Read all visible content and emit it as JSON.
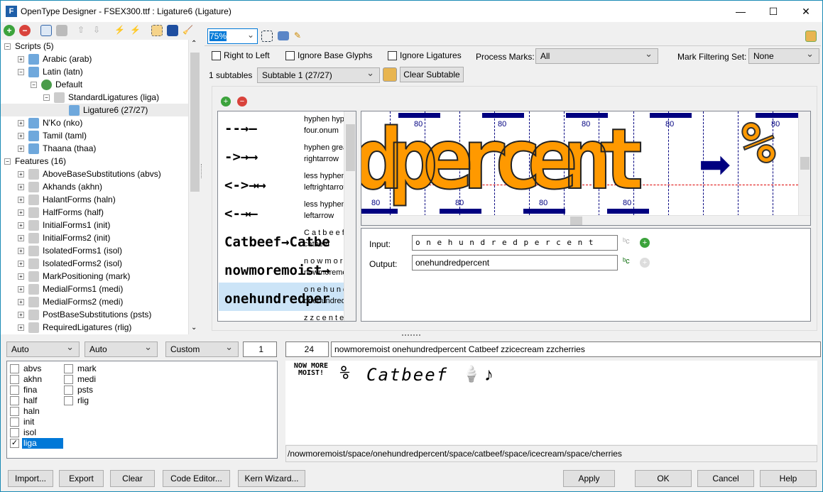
{
  "window": {
    "title": "OpenType Designer - FSEX300.ttf : Ligature6 (Ligature)",
    "minimize": "—",
    "maximize": "☐",
    "close": "✕"
  },
  "left_toolbar": {
    "icons": [
      "add-icon",
      "remove-icon",
      "tag-icon",
      "xyz-icon",
      "up-arrow-icon",
      "down-arrow-icon",
      "lightning-tag-icon",
      "lightning-disabled-icon",
      "tree-layout-icon",
      "window-icon",
      "broom-icon"
    ]
  },
  "tree": {
    "items": [
      {
        "label": "Scripts (5)",
        "level": 0,
        "expander": "−"
      },
      {
        "label": "Arabic (arab)",
        "level": 1,
        "expander": "+"
      },
      {
        "label": "Latin (latn)",
        "level": 1,
        "expander": "−"
      },
      {
        "label": "Default",
        "level": 2,
        "expander": "−"
      },
      {
        "label": "StandardLigatures (liga)",
        "level": 3,
        "expander": "−"
      },
      {
        "label": "Ligature6 (27/27)",
        "level": 4,
        "expander": "",
        "selected": true
      },
      {
        "label": "N'Ko (nko)",
        "level": 1,
        "expander": "+"
      },
      {
        "label": "Tamil (taml)",
        "level": 1,
        "expander": "+"
      },
      {
        "label": "Thaana (thaa)",
        "level": 1,
        "expander": "+"
      },
      {
        "label": "Features (16)",
        "level": 0,
        "expander": "−"
      },
      {
        "label": "AboveBaseSubstitutions (abvs)",
        "level": 1,
        "expander": "+"
      },
      {
        "label": "Akhands (akhn)",
        "level": 1,
        "expander": "+"
      },
      {
        "label": "HalantForms (haln)",
        "level": 1,
        "expander": "+"
      },
      {
        "label": "HalfForms (half)",
        "level": 1,
        "expander": "+"
      },
      {
        "label": "InitialForms1 (init)",
        "level": 1,
        "expander": "+"
      },
      {
        "label": "InitialForms2 (init)",
        "level": 1,
        "expander": "+"
      },
      {
        "label": "IsolatedForms1 (isol)",
        "level": 1,
        "expander": "+"
      },
      {
        "label": "IsolatedForms2 (isol)",
        "level": 1,
        "expander": "+"
      },
      {
        "label": "MarkPositioning (mark)",
        "level": 1,
        "expander": "+"
      },
      {
        "label": "MedialForms1 (medi)",
        "level": 1,
        "expander": "+"
      },
      {
        "label": "MedialForms2 (medi)",
        "level": 1,
        "expander": "+"
      },
      {
        "label": "PostBaseSubstitutions (psts)",
        "level": 1,
        "expander": "+"
      },
      {
        "label": "RequiredLigatures (rlig)",
        "level": 1,
        "expander": "+"
      }
    ]
  },
  "right_toolbar": {
    "zoom": "75%"
  },
  "options": {
    "right_to_left": "Right to Left",
    "ignore_base": "Ignore Base Glyphs",
    "ignore_lig": "Ignore Ligatures",
    "process_marks_label": "Process Marks:",
    "process_marks_value": "All",
    "mark_filter_label": "Mark Filtering Set:",
    "mark_filter_value": "None"
  },
  "subtables": {
    "count": "1 subtables",
    "selected": "Subtable 1 (27/27)",
    "clear": "Clear Subtable"
  },
  "ligatures": [
    {
      "glyph": "--→—",
      "line1": "hyphen hyphen",
      "line2": "four.onum"
    },
    {
      "glyph": "->→⟶",
      "line1": "hyphen greater",
      "line2": "rightarrow"
    },
    {
      "glyph": "<->→⟷",
      "line1": "less hyphen",
      "line2": "leftrightarrow"
    },
    {
      "glyph": "<-→⟵",
      "line1": "less hyphen",
      "line2": "leftarrow"
    },
    {
      "glyph": "Catbeef→Catbe",
      "line1": "C a t b e e f",
      "line2": "catbeef"
    },
    {
      "glyph": "nowmoremoist→",
      "line1": "n o w m o r e",
      "line2": "nowmoremoist"
    },
    {
      "glyph": "onehundredper",
      "line1": "o n e h u n d",
      "line2": "onehundredpercent",
      "selected": true
    },
    {
      "glyph": "",
      "line1": "z z c e n t e r",
      "line2": ""
    }
  ],
  "glyph_view": {
    "text": "dpercent",
    "advance_labels": [
      "80",
      "80",
      "80",
      "80",
      "80",
      "80",
      "80",
      "80",
      "80",
      "80"
    ],
    "arrow": "➡",
    "fill": "#ff9900",
    "metric": "#000080"
  },
  "io": {
    "input_label": "Input:",
    "input_value": "o n e h u n d r e d p e r c e n t",
    "output_label": "Output:",
    "output_value": "onehundredpercent"
  },
  "bottom": {
    "sel1": "Auto",
    "sel2": "Auto",
    "sel3": "Custom",
    "spin1": "1",
    "size": "24",
    "preview_text": "nowmoremoist onehundredpercent Catbeef zzicecream zzcherries",
    "features": [
      {
        "tag": "abvs",
        "checked": false
      },
      {
        "tag": "akhn",
        "checked": false
      },
      {
        "tag": "fina",
        "checked": false
      },
      {
        "tag": "half",
        "checked": false
      },
      {
        "tag": "haln",
        "checked": false
      },
      {
        "tag": "init",
        "checked": false
      },
      {
        "tag": "isol",
        "checked": false
      },
      {
        "tag": "liga",
        "checked": true
      },
      {
        "tag": "mark",
        "checked": false
      },
      {
        "tag": "medi",
        "checked": false
      },
      {
        "tag": "psts",
        "checked": false
      },
      {
        "tag": "rlig",
        "checked": false
      }
    ],
    "preview_glyphs": {
      "nowmoremoist": "NOW MORE MOIST!",
      "percent": "%",
      "catbeef": "Catbeef",
      "icecream": "🍦",
      "cherries": "♪"
    },
    "glyph_path": "/nowmoremoist/space/onehundredpercent/space/catbeef/space/icecream/space/cherries"
  },
  "buttons": {
    "import": "Import...",
    "export": "Export",
    "clear": "Clear",
    "code_editor": "Code Editor...",
    "kern_wizard": "Kern Wizard...",
    "apply": "Apply",
    "ok": "OK",
    "cancel": "Cancel",
    "help": "Help"
  }
}
